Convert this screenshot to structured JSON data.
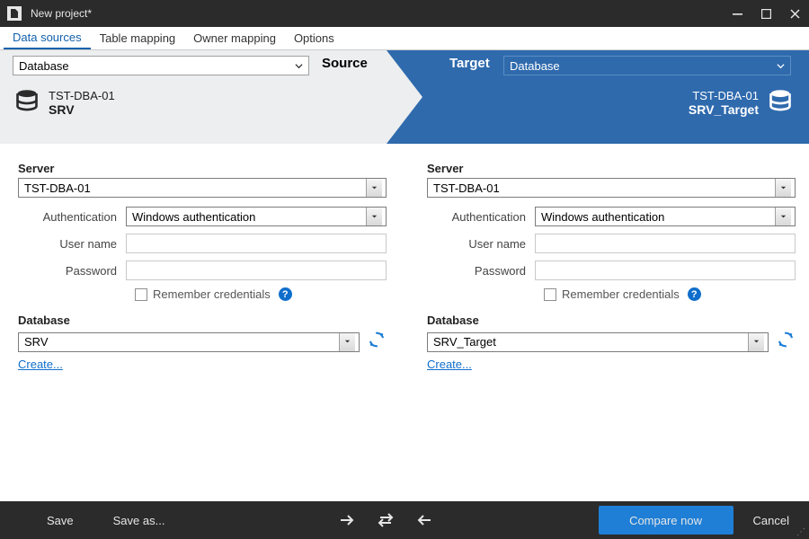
{
  "window": {
    "title": "New project*"
  },
  "tabs": [
    {
      "label": "Data sources",
      "active": true
    },
    {
      "label": "Table mapping"
    },
    {
      "label": "Owner mapping"
    },
    {
      "label": "Options"
    }
  ],
  "type_options": {
    "source": "Database",
    "target": "Database"
  },
  "labels": {
    "source": "Source",
    "target": "Target"
  },
  "source": {
    "server_label": "Server",
    "server": "TST-DBA-01",
    "auth_label": "Authentication",
    "auth": "Windows authentication",
    "user_label": "User name",
    "user": "",
    "pass_label": "Password",
    "pass": "",
    "remember_label": "Remember credentials",
    "db_section_label": "Database",
    "database": "SRV",
    "create_link": "Create..."
  },
  "target": {
    "server_label": "Server",
    "server": "TST-DBA-01",
    "auth_label": "Authentication",
    "auth": "Windows authentication",
    "user_label": "User name",
    "user": "",
    "pass_label": "Password",
    "pass": "",
    "remember_label": "Remember credentials",
    "db_section_label": "Database",
    "database": "SRV_Target",
    "create_link": "Create..."
  },
  "footer": {
    "save": "Save",
    "save_as": "Save as...",
    "compare": "Compare now",
    "cancel": "Cancel"
  }
}
